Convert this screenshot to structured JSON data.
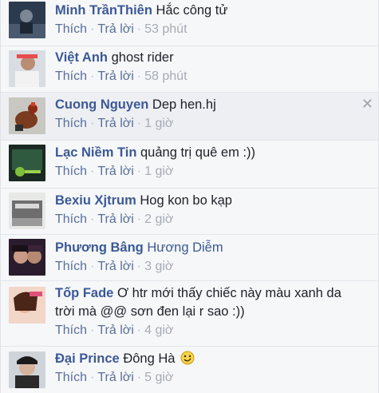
{
  "action_labels": {
    "like": "Thích",
    "reply": "Trả lời",
    "separator": "·"
  },
  "comments": [
    {
      "author": "Minh TrầnThiên",
      "text": "Hắc công tử",
      "time": "53 phút"
    },
    {
      "author": "Việt Anh",
      "text": "ghost rider",
      "time": "58 phút"
    },
    {
      "author": "Cuong Nguyen",
      "text": "Dep hen.hj",
      "time": "1 giờ"
    },
    {
      "author": "Lạc Niềm Tin",
      "text": "quảng trị quê em :))",
      "time": "1 giờ"
    },
    {
      "author": "Bexiu Xjtrum",
      "text": "Hog kon bo kạp",
      "time": "2 giờ"
    },
    {
      "author": "Phương Bâng",
      "text": "Hương Diễm",
      "time": "3 giờ"
    },
    {
      "author": "Tốp Fade",
      "text": "Ơ htr mới thấy chiếc này màu xanh da trời mà @@ sơn đen lại r sao :))",
      "time": "4 giờ"
    },
    {
      "author": "Đại Prince",
      "text": "Đông Hà",
      "time": "5 giờ"
    }
  ],
  "close_glyph": "✕"
}
